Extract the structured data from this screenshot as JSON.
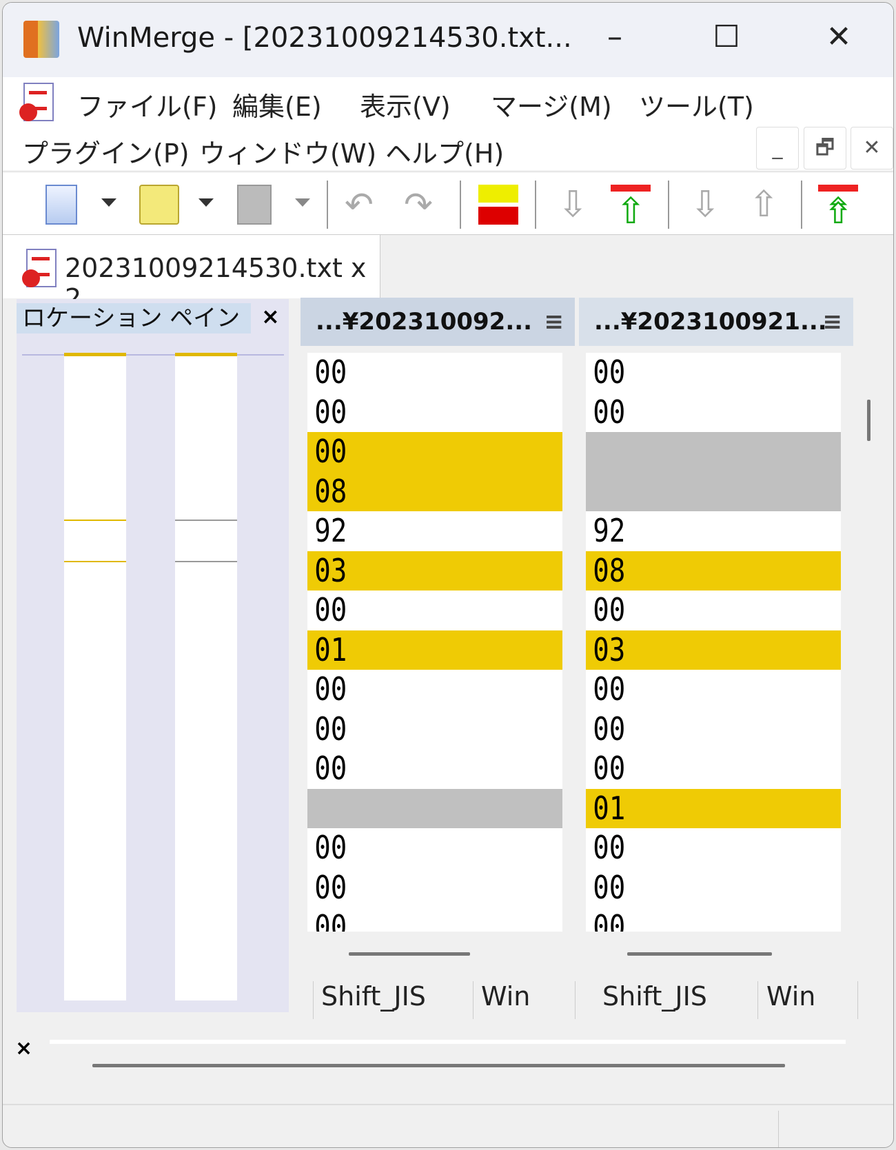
{
  "window": {
    "title": "WinMerge - [20231009214530.txt...",
    "minimize": "–",
    "maximize": "☐",
    "close": "✕"
  },
  "menu": {
    "items": [
      "ファイル(F)",
      "編集(E)",
      "表示(V)",
      "マージ(M)",
      "ツール(T)",
      "プラグイン(P)",
      "ウィンドウ(W)",
      "ヘルプ(H)"
    ],
    "mdi_min": "_",
    "mdi_restore": "🗗",
    "mdi_close": "✕"
  },
  "tab": {
    "label": "20231009214530.txt x 2"
  },
  "location_pane": {
    "title": "ロケーション ペイン",
    "close": "×"
  },
  "left_pane": {
    "header": "...¥202310092...",
    "menu": "≡",
    "lines": [
      {
        "t": "00",
        "s": ""
      },
      {
        "t": "00",
        "s": ""
      },
      {
        "t": "00",
        "s": "diff"
      },
      {
        "t": "08",
        "s": "diff"
      },
      {
        "t": "92",
        "s": ""
      },
      {
        "t": "03",
        "s": "diff"
      },
      {
        "t": "00",
        "s": ""
      },
      {
        "t": "01",
        "s": "diff"
      },
      {
        "t": "00",
        "s": ""
      },
      {
        "t": "00",
        "s": ""
      },
      {
        "t": "00",
        "s": ""
      },
      {
        "t": "",
        "s": "gap"
      },
      {
        "t": "00",
        "s": ""
      },
      {
        "t": "00",
        "s": ""
      },
      {
        "t": "00",
        "s": ""
      }
    ]
  },
  "right_pane": {
    "header": "...¥2023100921...",
    "menu": "≡",
    "lines": [
      {
        "t": "00",
        "s": ""
      },
      {
        "t": "00",
        "s": ""
      },
      {
        "t": "",
        "s": "gap"
      },
      {
        "t": "",
        "s": "gap"
      },
      {
        "t": "92",
        "s": ""
      },
      {
        "t": "08",
        "s": "diff"
      },
      {
        "t": "00",
        "s": ""
      },
      {
        "t": "03",
        "s": "diff"
      },
      {
        "t": "00",
        "s": ""
      },
      {
        "t": "00",
        "s": ""
      },
      {
        "t": "00",
        "s": ""
      },
      {
        "t": "01",
        "s": "diff"
      },
      {
        "t": "00",
        "s": ""
      },
      {
        "t": "00",
        "s": ""
      },
      {
        "t": "00",
        "s": ""
      }
    ]
  },
  "pane_status": {
    "left_encoding": "Shift_JIS",
    "left_eol": "Win",
    "right_encoding": "Shift_JIS",
    "right_eol": "Win"
  },
  "bottom_pane": {
    "close": "×"
  },
  "colors": {
    "diff": "#efcb05",
    "gap": "#c0c0c0"
  }
}
